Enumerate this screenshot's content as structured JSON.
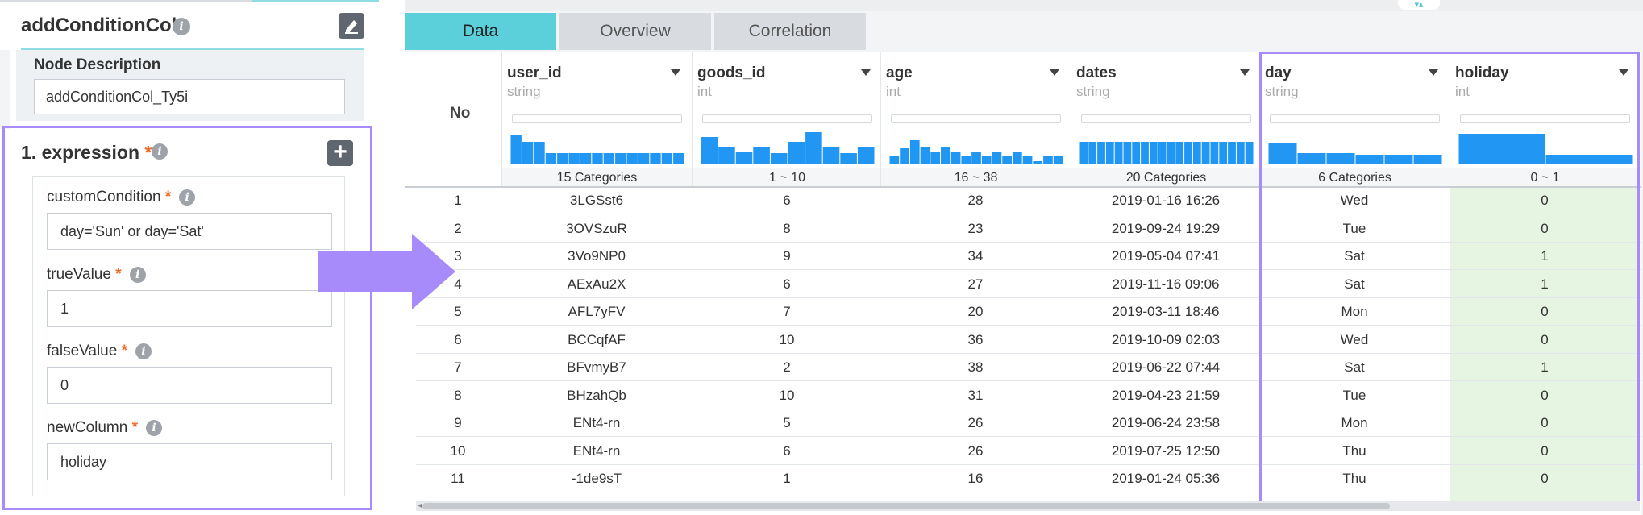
{
  "node": {
    "title": "addConditionCol",
    "description_label": "Node Description",
    "description_value": "addConditionCol_Ty5i"
  },
  "expression": {
    "title": "1. expression",
    "fields": [
      {
        "label": "customCondition",
        "value": "day='Sun' or day='Sat'"
      },
      {
        "label": "trueValue",
        "value": "1"
      },
      {
        "label": "falseValue",
        "value": "0"
      },
      {
        "label": "newColumn",
        "value": "holiday"
      }
    ]
  },
  "tabs": [
    "Data",
    "Overview",
    "Correlation"
  ],
  "table": {
    "no_label": "No",
    "columns": [
      {
        "name": "user_id",
        "type": "string",
        "range": "15 Categories",
        "hist": [
          0.9,
          0.7,
          0.7,
          0.35,
          0.35,
          0.35,
          0.35,
          0.35,
          0.35,
          0.35,
          0.35,
          0.35,
          0.35,
          0.35,
          0.35
        ]
      },
      {
        "name": "goods_id",
        "type": "int",
        "range": "1 ~ 10",
        "hist": [
          0.85,
          0.55,
          0.4,
          0.55,
          0.35,
          0.7,
          1.0,
          0.55,
          0.35,
          0.55
        ]
      },
      {
        "name": "age",
        "type": "int",
        "range": "16 ~ 38",
        "hist": [
          0.25,
          0.5,
          0.75,
          0.55,
          0.4,
          0.55,
          0.4,
          0.25,
          0.4,
          0.25,
          0.4,
          0.25,
          0.4,
          0.25,
          0.1,
          0.25,
          0.25
        ]
      },
      {
        "name": "dates",
        "type": "string",
        "range": "20 Categories",
        "hist": [
          0.7,
          0.7,
          0.7,
          0.7,
          0.7,
          0.7,
          0.7,
          0.7,
          0.7,
          0.7,
          0.7,
          0.7,
          0.7,
          0.7,
          0.7,
          0.7,
          0.7,
          0.7,
          0.7,
          0.7
        ]
      },
      {
        "name": "day",
        "type": "string",
        "range": "6 Categories",
        "hist": [
          0.65,
          0.35,
          0.35,
          0.3,
          0.3,
          0.3
        ]
      },
      {
        "name": "holiday",
        "type": "int",
        "range": "0 ~ 1",
        "hist": [
          0.95,
          0.3
        ]
      }
    ],
    "rows": [
      [
        "1",
        "3LGSst6",
        "6",
        "28",
        "2019-01-16 16:26",
        "Wed",
        "0"
      ],
      [
        "2",
        "3OVSzuR",
        "8",
        "23",
        "2019-09-24 19:29",
        "Tue",
        "0"
      ],
      [
        "3",
        "3Vo9NP0",
        "9",
        "34",
        "2019-05-04 07:41",
        "Sat",
        "1"
      ],
      [
        "4",
        "AExAu2X",
        "6",
        "27",
        "2019-11-16 09:06",
        "Sat",
        "1"
      ],
      [
        "5",
        "AFL7yFV",
        "7",
        "20",
        "2019-03-11 18:46",
        "Mon",
        "0"
      ],
      [
        "6",
        "BCCqfAF",
        "10",
        "36",
        "2019-10-09 02:03",
        "Wed",
        "0"
      ],
      [
        "7",
        "BFvmyB7",
        "2",
        "38",
        "2019-06-22 07:44",
        "Sat",
        "1"
      ],
      [
        "8",
        "BHzahQb",
        "10",
        "31",
        "2019-04-23 21:59",
        "Tue",
        "0"
      ],
      [
        "9",
        "ENt4-rn",
        "5",
        "26",
        "2019-06-24 23:58",
        "Mon",
        "0"
      ],
      [
        "10",
        "ENt4-rn",
        "6",
        "26",
        "2019-07-25 12:50",
        "Thu",
        "0"
      ],
      [
        "11",
        "-1de9sT",
        "1",
        "16",
        "2019-01-24 05:36",
        "Thu",
        "0"
      ]
    ]
  },
  "colors": {
    "accent": "#5bd0da",
    "highlight": "#a78bfa",
    "bar": "#2196f3",
    "required": "#f26b2a",
    "holiday_bg": "#e6f5e1"
  }
}
